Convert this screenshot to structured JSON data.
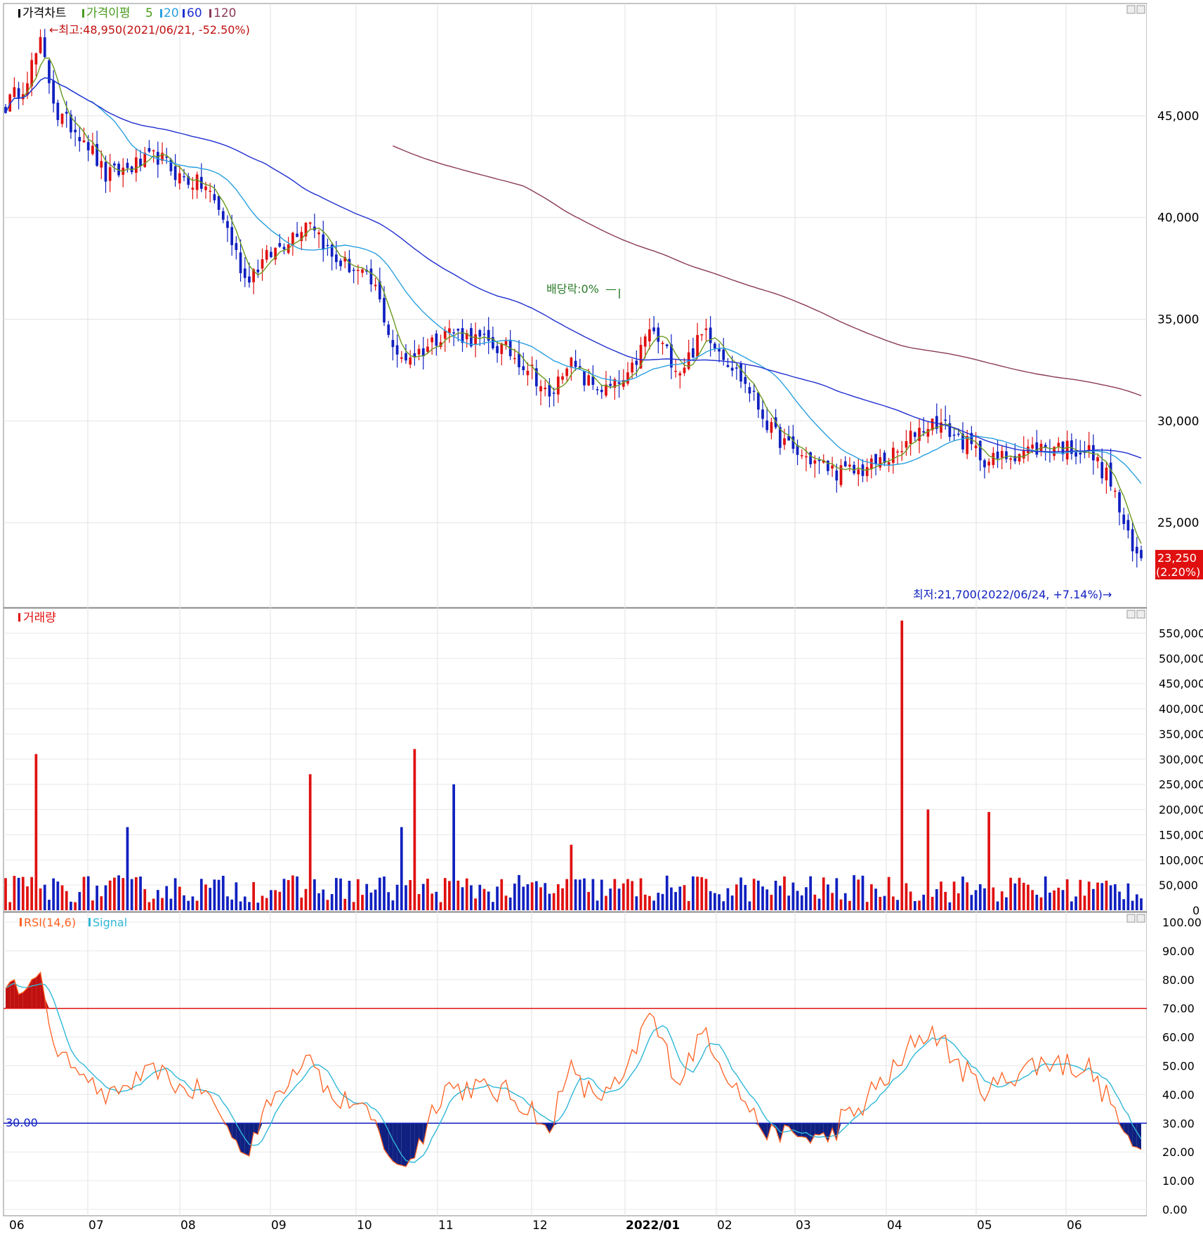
{
  "chart_data": [
    {
      "type": "candlestick",
      "panel": "price",
      "legend": {
        "price_label": "가격차트",
        "ma_label": "가격이평",
        "ma_periods": [
          "5",
          "20",
          "60",
          "120"
        ]
      },
      "ma_colors": {
        "ma5": "#6a9a1f",
        "ma20": "#2aa0e0",
        "ma60": "#1f2fd0",
        "ma120": "#8b3a5a"
      },
      "up_color": "#e01010",
      "down_color": "#1020c0",
      "y_ticks": [
        "45,000",
        "40,000",
        "35,000",
        "30,000",
        "25,000"
      ],
      "ylim": [
        21000,
        50000
      ],
      "x_ticks": [
        "06",
        "07",
        "08",
        "09",
        "10",
        "11",
        "12",
        "2022/01",
        "02",
        "03",
        "04",
        "05",
        "06"
      ],
      "annotations": {
        "high": "←최고:48,950(2021/06/21, -52.50%)",
        "low": "최저:21,700(2022/06/24, +7.14%)→",
        "dividend": "배당락:0%"
      },
      "last_price": "23,250",
      "last_change": "(2.20%)",
      "series": [
        {
          "name": "5",
          "key": "ma5"
        },
        {
          "name": "20",
          "key": "ma20"
        },
        {
          "name": "60",
          "key": "ma60"
        },
        {
          "name": "120",
          "key": "ma120"
        }
      ],
      "monthly_close_approx": [
        {
          "x": "2021/06",
          "close": 45500
        },
        {
          "x": "2021/07",
          "close": 43500
        },
        {
          "x": "2021/08",
          "close": 37800
        },
        {
          "x": "2021/09",
          "close": 37500
        },
        {
          "x": "2021/10",
          "close": 34500
        },
        {
          "x": "2021/11",
          "close": 32500
        },
        {
          "x": "2021/12",
          "close": 34500
        },
        {
          "x": "2022/01",
          "close": 31500
        },
        {
          "x": "2022/02",
          "close": 27500
        },
        {
          "x": "2022/03",
          "close": 28000
        },
        {
          "x": "2022/04",
          "close": 28500
        },
        {
          "x": "2022/05",
          "close": 28500
        },
        {
          "x": "2022/06",
          "close": 23250
        }
      ]
    },
    {
      "type": "bar",
      "panel": "volume",
      "title": "거래량",
      "y_ticks": [
        "550,000",
        "500,000",
        "450,000",
        "400,000",
        "350,000",
        "300,000",
        "250,000",
        "200,000",
        "150,000",
        "100,000",
        "50,000",
        "0"
      ],
      "ylim": [
        0,
        580000
      ],
      "peak_volumes": [
        {
          "x": "2021/06",
          "value": 310000
        },
        {
          "x": "2021/10",
          "value": 270000
        },
        {
          "x": "2021/11",
          "value": 320000
        },
        {
          "x": "2021/12",
          "value": 250000
        },
        {
          "x": "2022/05",
          "value": 575000
        },
        {
          "x": "2022/06",
          "value": 200000
        }
      ]
    },
    {
      "type": "line",
      "panel": "rsi",
      "legend": {
        "rsi": "RSI(14,6)",
        "signal": "Signal"
      },
      "upper_level": 70,
      "lower_level": 30,
      "lower_level_label": "30.00",
      "y_ticks": [
        "100.00",
        "90.00",
        "80.00",
        "70.00",
        "60.00",
        "50.00",
        "40.00",
        "30.00",
        "20.00",
        "10.00",
        "0.00"
      ],
      "ylim": [
        0,
        100
      ],
      "rsi_color": "#ff6020",
      "signal_color": "#30b8d8"
    }
  ]
}
